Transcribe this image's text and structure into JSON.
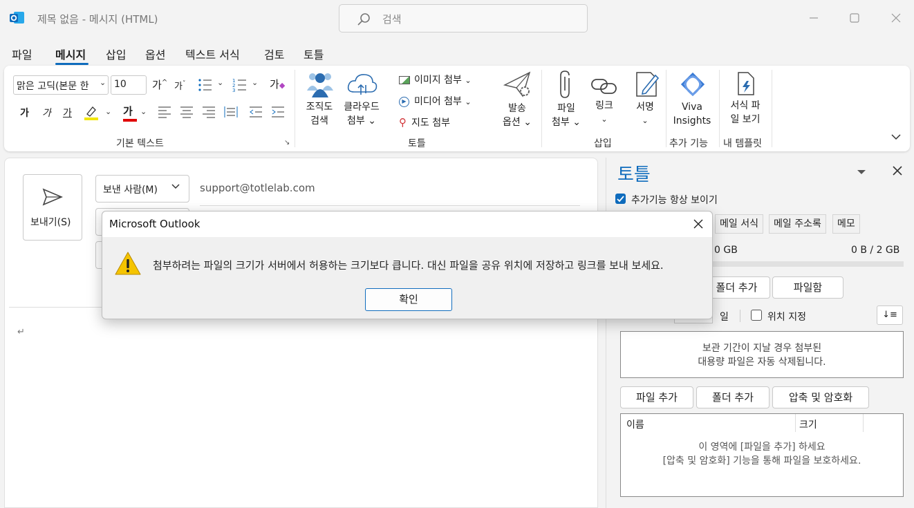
{
  "window": {
    "title": "제목 없음  -  메시지 (HTML)",
    "search_placeholder": "검색"
  },
  "menu_tabs": [
    "파일",
    "메시지",
    "삽입",
    "옵션",
    "텍스트 서식",
    "검토",
    "토틀"
  ],
  "ribbon": {
    "font_name": "맑은 고딕(본문 한",
    "font_size": "10",
    "bold_label": "가",
    "italic_label": "가",
    "underline_label": "가",
    "font_color_label": "가",
    "grow_label": "가",
    "shrink_label": "가",
    "clear_format_label": "가",
    "group_basic_text": "기본 텍스트",
    "org_search": [
      "조직도",
      "검색"
    ],
    "cloud_attach": [
      "클라우드",
      "첨부"
    ],
    "image_attach": "이미지 첨부",
    "media_attach": "미디어 첨부",
    "map_attach": "지도 첨부",
    "send_options": [
      "발송",
      "옵션"
    ],
    "group_totle": "토틀",
    "file_attach": [
      "파일",
      "첨부"
    ],
    "link": "링크",
    "signature": "서명",
    "group_insert": "삽입",
    "viva": [
      "Viva",
      "Insights"
    ],
    "group_addins": "추가 기능",
    "view_templates": [
      "서식 파",
      "일 보기"
    ],
    "group_templates": "내 템플릿"
  },
  "compose": {
    "send_label": "보내기(S)",
    "from_label": "보낸 사람(M)",
    "from_email": "support@totlelab.com",
    "paragraph_mark": "↵"
  },
  "pane": {
    "title": "토틀",
    "always_show": "추가기능 항상 보이기",
    "tabs": [
      "메일 서식",
      "메일 주소록",
      "메모"
    ],
    "storage_left": "0 GB",
    "storage_right": "0 B / 2 GB",
    "storage_percent": 0,
    "add_folder_top": "폴더 추가",
    "file_box": "파일함",
    "day_label": "일",
    "location_label": "위치 지정",
    "notice_line1": "보관 기간이 지날 경우 첨부된",
    "notice_line2": "대용량 파일은 자동 삭제됩니다.",
    "add_file": "파일 추가",
    "add_folder": "폴더 추가",
    "compress": "압축 및 암호화",
    "col_name": "이름",
    "col_size": "크기",
    "empty_line1": "이 영역에 [파일을 추가] 하세요",
    "empty_line2": "[압축 및 암호화] 기능을 통해 파일을 보호하세요."
  },
  "dialog": {
    "title": "Microsoft Outlook",
    "message": "첨부하려는 파일의 크기가 서버에서 허용하는 크기보다 큽니다. 대신 파일을 공유 위치에 저장하고 링크를 보내 보세요.",
    "ok_label": "확인"
  },
  "colors": {
    "accent": "#0f6cbd",
    "highlight": "#f2e600",
    "font_color": "#e00000",
    "warning": "#f5c400"
  }
}
